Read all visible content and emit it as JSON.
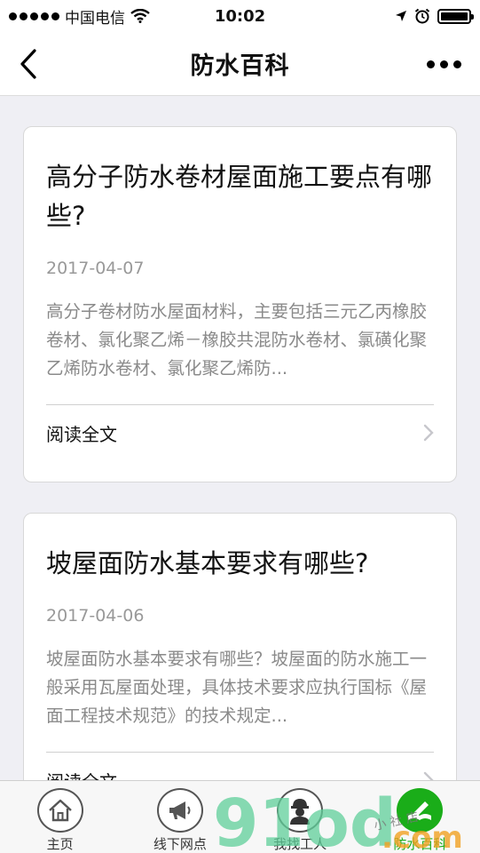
{
  "status_bar": {
    "carrier": "中国电信",
    "time": "10:02"
  },
  "nav": {
    "title": "防水百科",
    "back_icon": "chevron-left-icon",
    "more_icon": "more-dots-icon"
  },
  "articles": [
    {
      "title": "高分子防水卷材屋面施工要点有哪些?",
      "date": "2017-04-07",
      "summary": "高分子卷材防水屋面材料，主要包括三元乙丙橡胶卷材、氯化聚乙烯－橡胶共混防水卷材、氯磺化聚乙烯防水卷材、氯化聚乙烯防...",
      "read_more": "阅读全文"
    },
    {
      "title": "坡屋面防水基本要求有哪些?",
      "date": "2017-04-06",
      "summary": "坡屋面防水基本要求有哪些？坡屋面的防水施工一般采用瓦屋面处理，具体技术要求应执行国标《屋面工程技术规范》的技术规定...",
      "read_more": "阅读全文"
    }
  ],
  "tabs": [
    {
      "label": "主页",
      "icon": "home-icon",
      "active": false
    },
    {
      "label": "线下网点",
      "icon": "megaphone-icon",
      "active": false
    },
    {
      "label": "我找工人",
      "icon": "worker-icon",
      "active": false
    },
    {
      "label": "防水百科",
      "icon": "book-pencil-icon",
      "active": true
    }
  ],
  "colors": {
    "accent": "#1aad19",
    "background": "#efeff4"
  },
  "watermark": {
    "brand": "91od",
    "domain": ".com",
    "handwriting": "小 社 店"
  }
}
